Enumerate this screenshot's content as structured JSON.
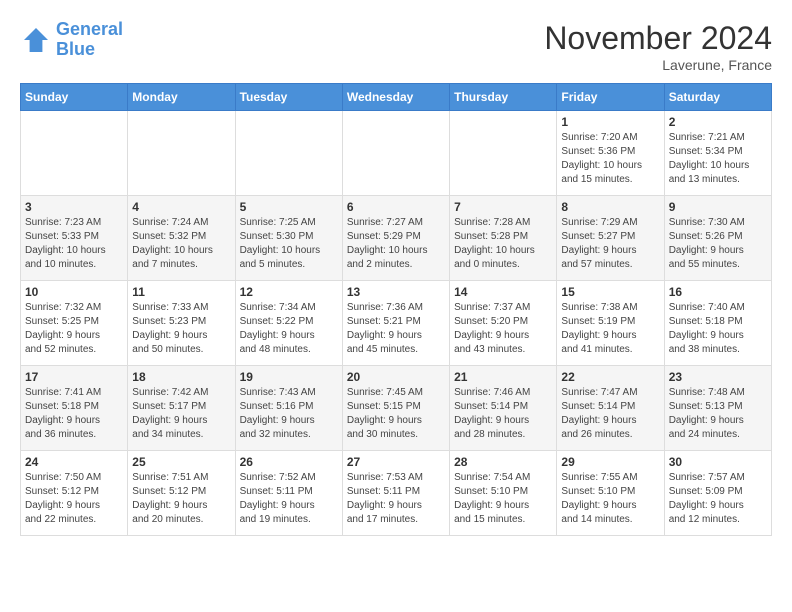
{
  "header": {
    "logo_line1": "General",
    "logo_line2": "Blue",
    "month": "November 2024",
    "location": "Laverune, France"
  },
  "weekdays": [
    "Sunday",
    "Monday",
    "Tuesday",
    "Wednesday",
    "Thursday",
    "Friday",
    "Saturday"
  ],
  "weeks": [
    [
      {
        "day": "",
        "info": ""
      },
      {
        "day": "",
        "info": ""
      },
      {
        "day": "",
        "info": ""
      },
      {
        "day": "",
        "info": ""
      },
      {
        "day": "",
        "info": ""
      },
      {
        "day": "1",
        "info": "Sunrise: 7:20 AM\nSunset: 5:36 PM\nDaylight: 10 hours\nand 15 minutes."
      },
      {
        "day": "2",
        "info": "Sunrise: 7:21 AM\nSunset: 5:34 PM\nDaylight: 10 hours\nand 13 minutes."
      }
    ],
    [
      {
        "day": "3",
        "info": "Sunrise: 7:23 AM\nSunset: 5:33 PM\nDaylight: 10 hours\nand 10 minutes."
      },
      {
        "day": "4",
        "info": "Sunrise: 7:24 AM\nSunset: 5:32 PM\nDaylight: 10 hours\nand 7 minutes."
      },
      {
        "day": "5",
        "info": "Sunrise: 7:25 AM\nSunset: 5:30 PM\nDaylight: 10 hours\nand 5 minutes."
      },
      {
        "day": "6",
        "info": "Sunrise: 7:27 AM\nSunset: 5:29 PM\nDaylight: 10 hours\nand 2 minutes."
      },
      {
        "day": "7",
        "info": "Sunrise: 7:28 AM\nSunset: 5:28 PM\nDaylight: 10 hours\nand 0 minutes."
      },
      {
        "day": "8",
        "info": "Sunrise: 7:29 AM\nSunset: 5:27 PM\nDaylight: 9 hours\nand 57 minutes."
      },
      {
        "day": "9",
        "info": "Sunrise: 7:30 AM\nSunset: 5:26 PM\nDaylight: 9 hours\nand 55 minutes."
      }
    ],
    [
      {
        "day": "10",
        "info": "Sunrise: 7:32 AM\nSunset: 5:25 PM\nDaylight: 9 hours\nand 52 minutes."
      },
      {
        "day": "11",
        "info": "Sunrise: 7:33 AM\nSunset: 5:23 PM\nDaylight: 9 hours\nand 50 minutes."
      },
      {
        "day": "12",
        "info": "Sunrise: 7:34 AM\nSunset: 5:22 PM\nDaylight: 9 hours\nand 48 minutes."
      },
      {
        "day": "13",
        "info": "Sunrise: 7:36 AM\nSunset: 5:21 PM\nDaylight: 9 hours\nand 45 minutes."
      },
      {
        "day": "14",
        "info": "Sunrise: 7:37 AM\nSunset: 5:20 PM\nDaylight: 9 hours\nand 43 minutes."
      },
      {
        "day": "15",
        "info": "Sunrise: 7:38 AM\nSunset: 5:19 PM\nDaylight: 9 hours\nand 41 minutes."
      },
      {
        "day": "16",
        "info": "Sunrise: 7:40 AM\nSunset: 5:18 PM\nDaylight: 9 hours\nand 38 minutes."
      }
    ],
    [
      {
        "day": "17",
        "info": "Sunrise: 7:41 AM\nSunset: 5:18 PM\nDaylight: 9 hours\nand 36 minutes."
      },
      {
        "day": "18",
        "info": "Sunrise: 7:42 AM\nSunset: 5:17 PM\nDaylight: 9 hours\nand 34 minutes."
      },
      {
        "day": "19",
        "info": "Sunrise: 7:43 AM\nSunset: 5:16 PM\nDaylight: 9 hours\nand 32 minutes."
      },
      {
        "day": "20",
        "info": "Sunrise: 7:45 AM\nSunset: 5:15 PM\nDaylight: 9 hours\nand 30 minutes."
      },
      {
        "day": "21",
        "info": "Sunrise: 7:46 AM\nSunset: 5:14 PM\nDaylight: 9 hours\nand 28 minutes."
      },
      {
        "day": "22",
        "info": "Sunrise: 7:47 AM\nSunset: 5:14 PM\nDaylight: 9 hours\nand 26 minutes."
      },
      {
        "day": "23",
        "info": "Sunrise: 7:48 AM\nSunset: 5:13 PM\nDaylight: 9 hours\nand 24 minutes."
      }
    ],
    [
      {
        "day": "24",
        "info": "Sunrise: 7:50 AM\nSunset: 5:12 PM\nDaylight: 9 hours\nand 22 minutes."
      },
      {
        "day": "25",
        "info": "Sunrise: 7:51 AM\nSunset: 5:12 PM\nDaylight: 9 hours\nand 20 minutes."
      },
      {
        "day": "26",
        "info": "Sunrise: 7:52 AM\nSunset: 5:11 PM\nDaylight: 9 hours\nand 19 minutes."
      },
      {
        "day": "27",
        "info": "Sunrise: 7:53 AM\nSunset: 5:11 PM\nDaylight: 9 hours\nand 17 minutes."
      },
      {
        "day": "28",
        "info": "Sunrise: 7:54 AM\nSunset: 5:10 PM\nDaylight: 9 hours\nand 15 minutes."
      },
      {
        "day": "29",
        "info": "Sunrise: 7:55 AM\nSunset: 5:10 PM\nDaylight: 9 hours\nand 14 minutes."
      },
      {
        "day": "30",
        "info": "Sunrise: 7:57 AM\nSunset: 5:09 PM\nDaylight: 9 hours\nand 12 minutes."
      }
    ]
  ]
}
